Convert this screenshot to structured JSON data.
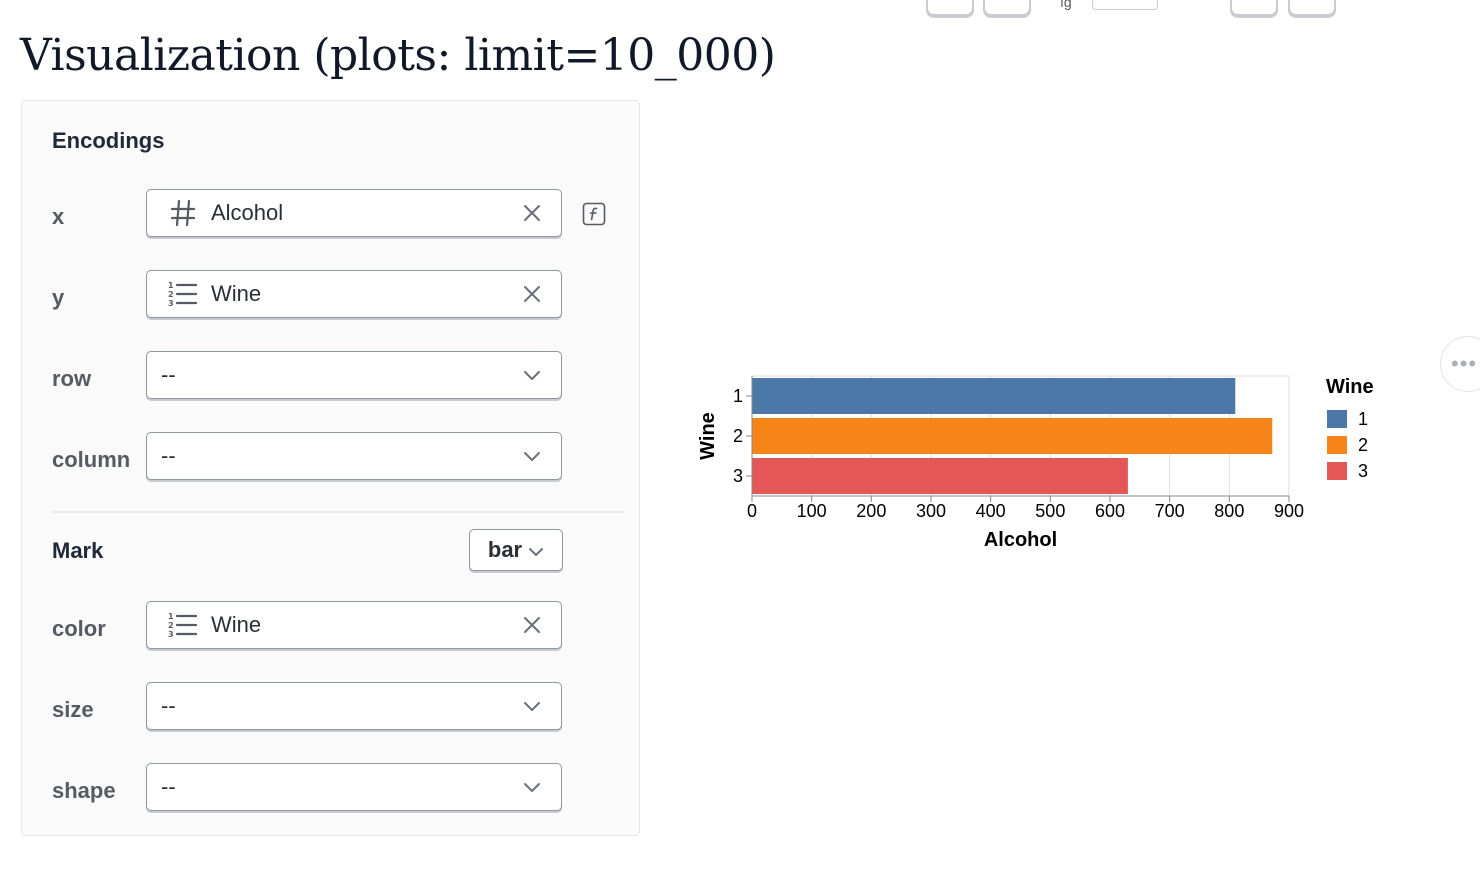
{
  "page": {
    "title": "Visualization (plots: limit=10_000)"
  },
  "toolbar": {
    "partial_text": "ıg"
  },
  "encodings": {
    "title": "Encodings",
    "x": {
      "label": "x",
      "value": "Alcohol",
      "type_icon": "hash-icon"
    },
    "y": {
      "label": "y",
      "value": "Wine",
      "type_icon": "ordered-list-icon"
    },
    "row": {
      "label": "row",
      "value": "--"
    },
    "column": {
      "label": "column",
      "value": "--"
    }
  },
  "mark": {
    "title": "Mark",
    "selected": "bar",
    "color": {
      "label": "color",
      "value": "Wine",
      "type_icon": "ordered-list-icon"
    },
    "size": {
      "label": "size",
      "value": "--"
    },
    "shape": {
      "label": "shape",
      "value": "--"
    }
  },
  "chart_data": {
    "type": "bar",
    "orientation": "horizontal",
    "xlabel": "Alcohol",
    "ylabel": "Wine",
    "categories": [
      "1",
      "2",
      "3"
    ],
    "values": [
      810,
      872,
      630
    ],
    "colors": [
      "#4c78a8",
      "#f58518",
      "#e45756"
    ],
    "xlim": [
      0,
      900
    ],
    "xticks": [
      0,
      100,
      200,
      300,
      400,
      500,
      600,
      700,
      800,
      900
    ],
    "grid": true,
    "legend": {
      "title": "Wine",
      "entries": [
        "1",
        "2",
        "3"
      ],
      "placement": "right"
    }
  }
}
